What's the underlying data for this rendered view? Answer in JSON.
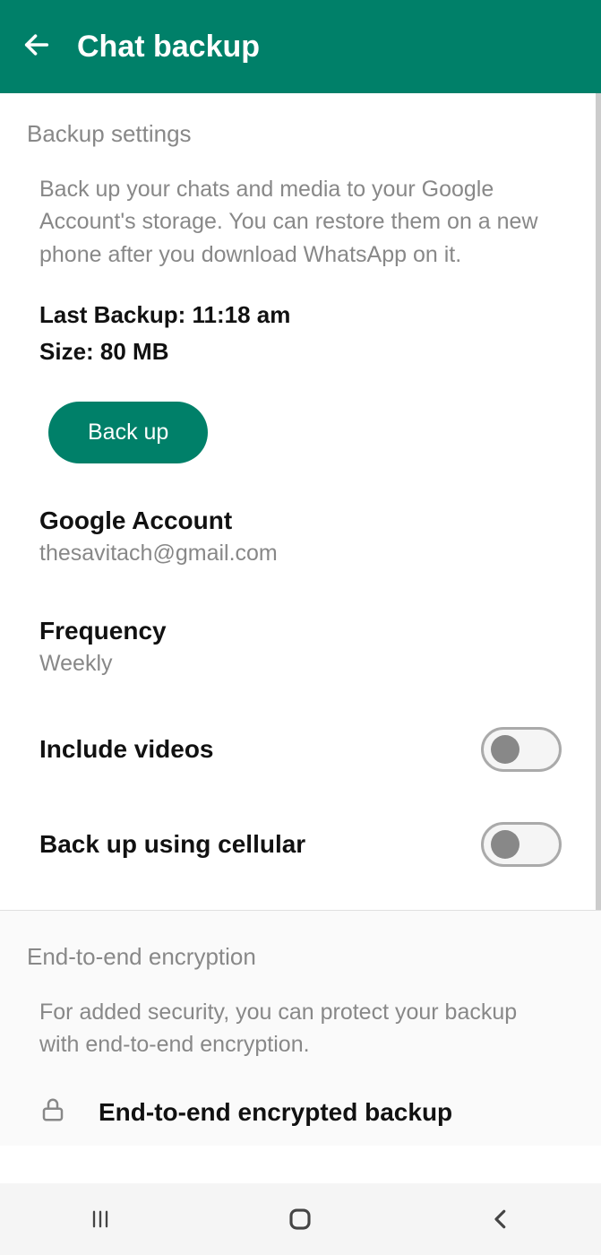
{
  "header": {
    "title": "Chat backup"
  },
  "backup_settings": {
    "section_title": "Backup settings",
    "description": "Back up your chats and media to your Google Account's storage. You can restore them on a new phone after you download WhatsApp on it.",
    "last_backup": "Last Backup: 11:18 am",
    "size": "Size: 80 MB",
    "backup_button": "Back up",
    "google_account": {
      "title": "Google Account",
      "value": "thesavitach@gmail.com"
    },
    "frequency": {
      "title": "Frequency",
      "value": "Weekly"
    },
    "include_videos": "Include videos",
    "cellular": "Back up using cellular"
  },
  "e2e": {
    "section_title": "End-to-end encryption",
    "description": "For added security, you can protect your backup with end-to-end encryption.",
    "row_title": "End-to-end encrypted backup"
  }
}
